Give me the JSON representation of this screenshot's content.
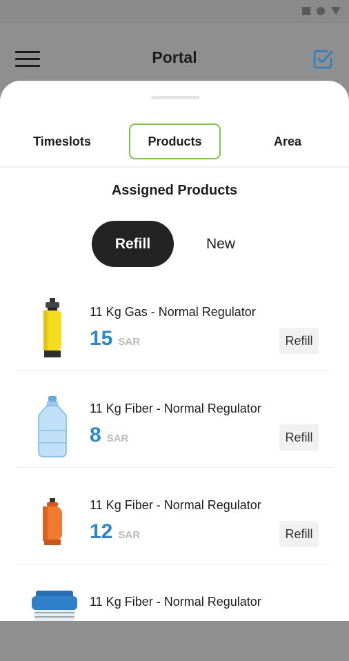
{
  "appbar": {
    "title": "Portal"
  },
  "icons": {
    "menu": "hamburger-menu-icon",
    "check": "check-square-icon",
    "status": [
      "square-icon",
      "circle-icon",
      "triangle-icon"
    ]
  },
  "colors": {
    "accent": "#2c86c8",
    "tab_border": "#7dc44f",
    "active_toggle": "#232323",
    "check_icon": "#2a7fc6"
  },
  "tabs": [
    {
      "label": "Timeslots"
    },
    {
      "label": "Products",
      "active": true
    },
    {
      "label": "Area"
    }
  ],
  "section_title": "Assigned Products",
  "toggle": {
    "refill": "Refill",
    "new": "New",
    "selected": "Refill"
  },
  "products": [
    {
      "name": "11 Kg Gas - Normal Regulator",
      "price": "15",
      "currency": "SAR",
      "action": "Refill",
      "image": "yellow-gas-cylinder"
    },
    {
      "name": "11 Kg Fiber - Normal Regulator",
      "price": "8",
      "currency": "SAR",
      "action": "Refill",
      "image": "water-bottle"
    },
    {
      "name": "11 Kg Fiber - Normal Regulator",
      "price": "12",
      "currency": "SAR",
      "action": "Refill",
      "image": "orange-gas-cylinder"
    },
    {
      "name": "11 Kg Fiber - Normal Regulator",
      "image": "blue-fiber-cylinder"
    }
  ]
}
